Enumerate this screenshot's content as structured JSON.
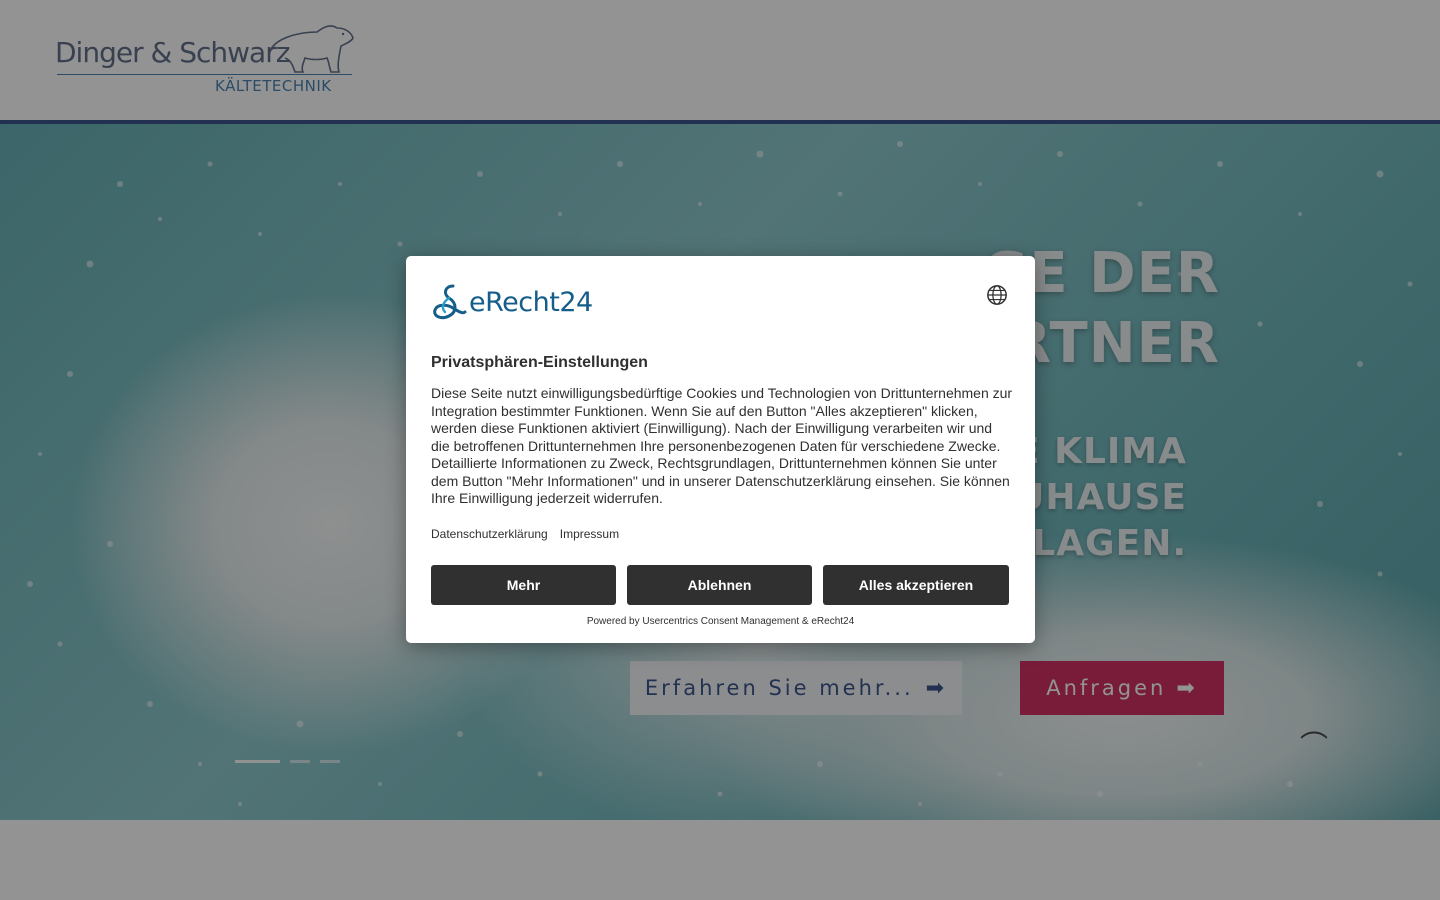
{
  "header": {
    "logo_main": "Dinger & Schwarz",
    "logo_sub": "KÄLTETECHNIK",
    "logo_icon": "polar-bear-icon"
  },
  "hero": {
    "heading_lines": [
      "...GE DER",
      "...RTNER"
    ],
    "subheading_lines": [
      "...E KLIMA",
      "...UHAUSE",
      "...NLAGEN."
    ],
    "btn_more_label": "Erfahren Sie mehr...",
    "btn_request_label": "Anfragen",
    "arrow_icon": "arrow-right-icon",
    "slider_dots": 3,
    "active_slide": 1
  },
  "consent": {
    "brand": "eRecht24",
    "brand_icon": "erecht24-logo-icon",
    "language_icon": "globe-icon",
    "title": "Privatsphären-Einstellungen",
    "body": "Diese Seite nutzt einwilligungsbedürftige Cookies und Technologien von Drittunternehmen zur Integration bestimmter Funktionen. Wenn Sie auf den Button \"Alles akzeptieren\" klicken, werden diese Funktionen aktiviert (Einwilligung). Nach der Einwilligung verarbeiten wir und die betroffenen Drittunternehmen Ihre personenbezogenen Daten für verschiedene Zwecke. Detaillierte Informationen zu Zweck, Rechtsgrundlagen, Drittunternehmen können Sie unter dem Button \"Mehr Informationen\" und in unserer Datenschutzerklärung einsehen. Sie können Ihre Einwilligung jederzeit widerrufen.",
    "link_privacy": "Datenschutzerklärung",
    "link_imprint": "Impressum",
    "btn_more": "Mehr",
    "btn_decline": "Ablehnen",
    "btn_accept_all": "Alles akzeptieren",
    "powered_by": "Powered by Usercentrics Consent Management & eRecht24"
  },
  "colors": {
    "brand_navy": "#1e3a7b",
    "accent_pink": "#c8104a",
    "modal_button": "#303030",
    "erecht_blue": "#155d8a"
  }
}
